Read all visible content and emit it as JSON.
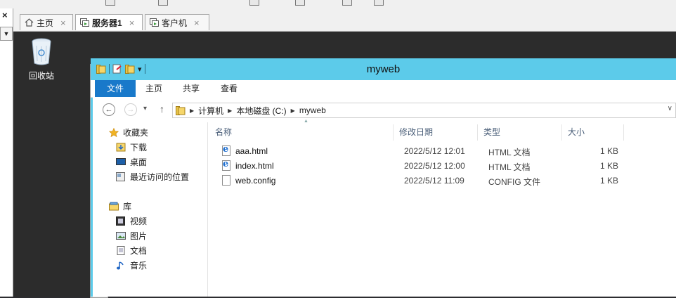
{
  "host": {
    "close_glyph": "×",
    "dropdown_glyph": "▼",
    "tabs": [
      {
        "label": "主页",
        "close": "×",
        "icon": "home-icon"
      },
      {
        "label": "服务器1",
        "close": "×",
        "icon": "vm-icon"
      },
      {
        "label": "客户机",
        "close": "×",
        "icon": "vm-icon"
      }
    ]
  },
  "desktop": {
    "recycle_bin_label": "回收站"
  },
  "explorer": {
    "title": "myweb",
    "qat_dropdown": "▾",
    "ribbon_tabs": [
      "文件",
      "主页",
      "共享",
      "查看"
    ],
    "nav_back": "←",
    "nav_forward": "→",
    "nav_recent": "▾",
    "nav_up": "↑",
    "address": [
      "计算机",
      "本地磁盘 (C:)",
      "myweb"
    ],
    "address_sep": "▶",
    "address_drop": "∨",
    "nav": {
      "favorites": {
        "label": "收藏夹",
        "items": [
          "下载",
          "桌面",
          "最近访问的位置"
        ]
      },
      "libraries": {
        "label": "库",
        "items": [
          "视频",
          "图片",
          "文档",
          "音乐"
        ]
      }
    },
    "columns": [
      "名称",
      "修改日期",
      "类型",
      "大小"
    ],
    "sort_glyph": "▲",
    "files": [
      {
        "name": "aaa.html",
        "date": "2022/5/12 12:01",
        "type": "HTML 文档",
        "size": "1 KB",
        "kind": "html"
      },
      {
        "name": "index.html",
        "date": "2022/5/12 12:00",
        "type": "HTML 文档",
        "size": "1 KB",
        "kind": "html"
      },
      {
        "name": "web.config",
        "date": "2022/5/12 11:09",
        "type": "CONFIG 文件",
        "size": "1 KB",
        "kind": "config"
      }
    ]
  }
}
